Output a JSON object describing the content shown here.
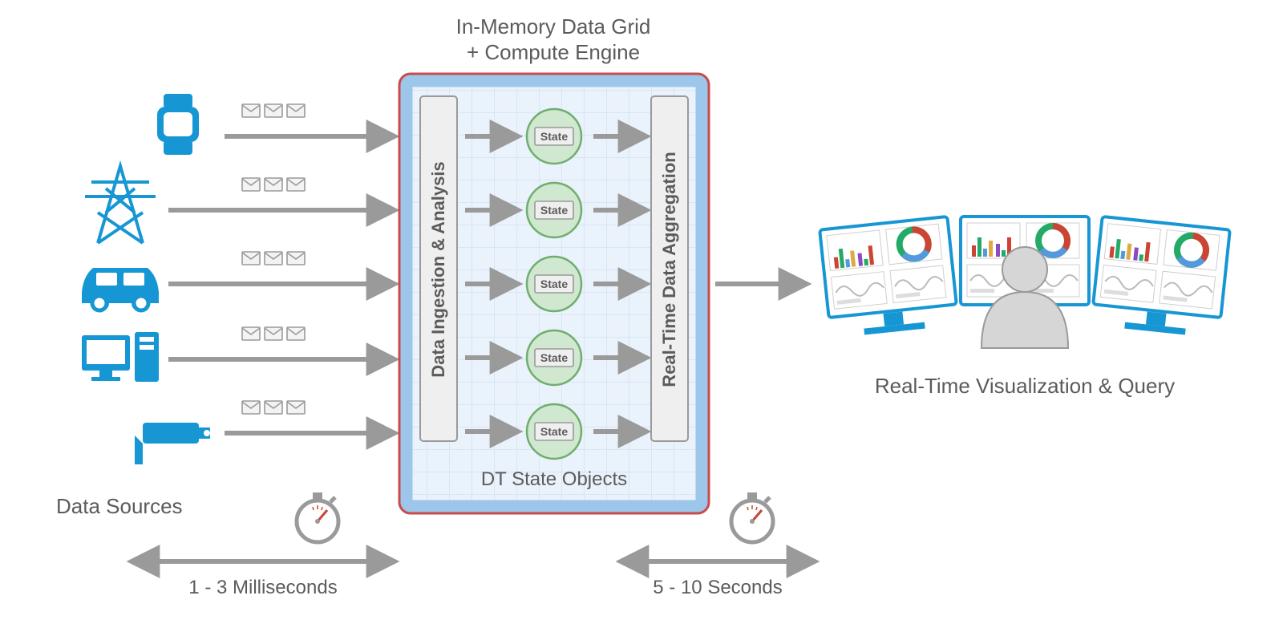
{
  "title_top": {
    "line1": "In-Memory Data Grid",
    "line2": "+ Compute Engine"
  },
  "sources": {
    "label": "Data Sources",
    "items": [
      "smartwatch",
      "power-tower",
      "car",
      "desktop-computer",
      "security-camera"
    ]
  },
  "grid": {
    "left_box": "Data Ingestion & Analysis",
    "right_box": "Real-Time Data Aggregation",
    "state_label": "State",
    "state_count": 5,
    "bottom_label": "DT State Objects"
  },
  "output": {
    "label": "Real-Time Visualization & Query"
  },
  "timing": {
    "left": "1 - 3 Milliseconds",
    "right": "5 - 10 Seconds"
  }
}
